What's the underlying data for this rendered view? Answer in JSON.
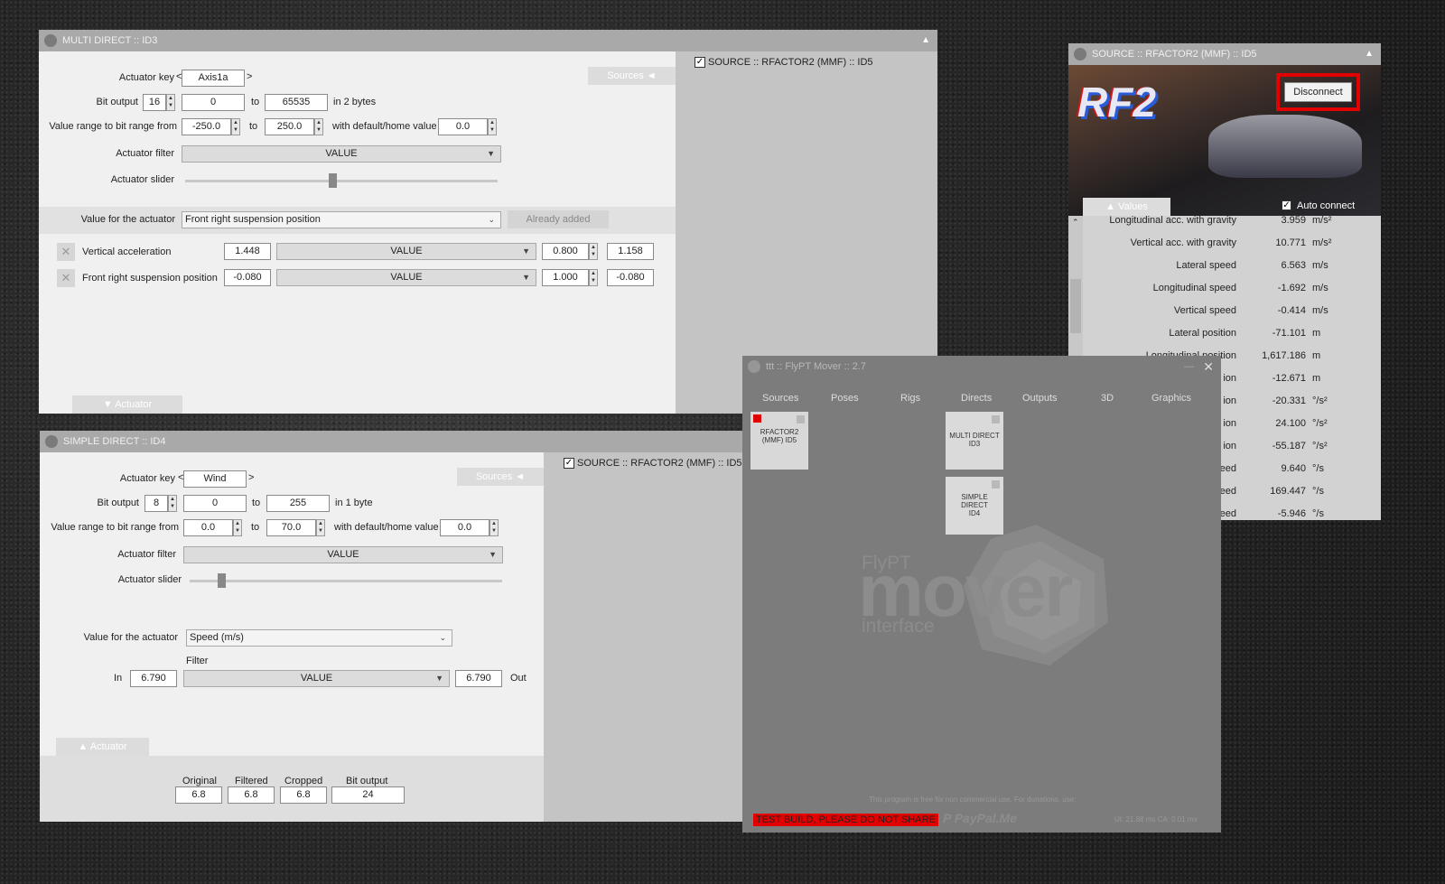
{
  "multi_direct": {
    "title": "MULTI DIRECT :: ID3",
    "actuator_key_label": "Actuator key",
    "actuator_key_value": "Axis1a",
    "bit_output_label": "Bit output",
    "bit_output_value": "16",
    "bit_from": "0",
    "to_label": "to",
    "bit_to": "65535",
    "bytes_label": "in 2 bytes",
    "range_label": "Value range to bit range from",
    "range_from": "-250.0",
    "range_to": "250.0",
    "default_label": "with default/home value",
    "default_value": "0.0",
    "filter_label": "Actuator filter",
    "filter_value": "VALUE",
    "slider_label": "Actuator slider",
    "slider_level": 0.47,
    "sources_tab": "Sources",
    "value_label": "Value for the actuator",
    "value_select": "Front right suspension position",
    "already_added": "Already added",
    "rows": [
      {
        "name": "Vertical acceleration",
        "input": "1.448",
        "filter": "VALUE",
        "gain": "0.800",
        "output": "1.158"
      },
      {
        "name": "Front right suspension position",
        "input": "-0.080",
        "filter": "VALUE",
        "gain": "1.000",
        "output": "-0.080"
      }
    ],
    "actuator_tab": "Actuator",
    "source_check": "SOURCE :: RFACTOR2 (MMF) :: ID5"
  },
  "simple_direct": {
    "title": "SIMPLE DIRECT :: ID4",
    "actuator_key_label": "Actuator key",
    "actuator_key_value": "Wind",
    "bit_output_label": "Bit output",
    "bit_output_value": "8",
    "bit_from": "0",
    "to_label": "to",
    "bit_to": "255",
    "bytes_label": "in 1 byte",
    "range_label": "Value range to bit range from",
    "range_from": "0.0",
    "range_to": "70.0",
    "default_label": "with default/home value",
    "default_value": "0.0",
    "filter_label": "Actuator filter",
    "filter_value": "VALUE",
    "slider_label": "Actuator slider",
    "slider_level": 0.1,
    "sources_tab": "Sources",
    "value_label": "Value for the actuator",
    "value_select": "Speed (m/s)",
    "filter_caption": "Filter",
    "in_label": "In",
    "in_value": "6.790",
    "mid_filter": "VALUE",
    "out_value": "6.790",
    "out_label": "Out",
    "actuator_tab": "Actuator",
    "stats": [
      {
        "label": "Original",
        "value": "6.8"
      },
      {
        "label": "Filtered",
        "value": "6.8"
      },
      {
        "label": "Cropped",
        "value": "6.8"
      },
      {
        "label": "Bit output",
        "value": "24"
      }
    ],
    "source_check": "SOURCE :: RFACTOR2 (MMF) :: ID5"
  },
  "source_win": {
    "title": "SOURCE :: RFACTOR2 (MMF) :: ID5",
    "disconnect": "Disconnect",
    "values_tab": "Values",
    "auto_connect": "Auto connect",
    "logo_text": "RF2",
    "values": [
      {
        "name": "Longitudinal acc. with gravity",
        "value": "3.959",
        "unit": "m/s²"
      },
      {
        "name": "Vertical acc. with gravity",
        "value": "10.771",
        "unit": "m/s²"
      },
      {
        "name": "Lateral speed",
        "value": "6.563",
        "unit": "m/s"
      },
      {
        "name": "Longitudinal speed",
        "value": "-1.692",
        "unit": "m/s"
      },
      {
        "name": "Vertical speed",
        "value": "-0.414",
        "unit": "m/s"
      },
      {
        "name": "Lateral position",
        "value": "-71.101",
        "unit": "m"
      },
      {
        "name": "Longitudinal position",
        "value": "1,617.186",
        "unit": "m"
      },
      {
        "name": "",
        "value": "-12.671",
        "unit": "m"
      },
      {
        "name": "",
        "value": "-20.331",
        "unit": "°/s²"
      },
      {
        "name": "",
        "value": "24.100",
        "unit": "°/s²"
      },
      {
        "name": "",
        "value": "-55.187",
        "unit": "°/s²"
      },
      {
        "name": "",
        "value": "9.640",
        "unit": "°/s"
      },
      {
        "name": "",
        "value": "169.447",
        "unit": "°/s"
      },
      {
        "name": "",
        "value": "-5.946",
        "unit": "°/s"
      }
    ],
    "partial_suffixes": [
      "ion",
      "ion",
      "ion",
      "ion",
      "eed",
      "eed",
      "eed"
    ]
  },
  "mover": {
    "title": "ttt :: FlyPT Mover :: 2.7",
    "tabs": [
      "Sources",
      "Poses",
      "Rigs",
      "Directs",
      "Outputs",
      "3D",
      "Graphics"
    ],
    "card_source": "RFACTOR2 (MMF) ID5",
    "card_multi": "MULTI DIRECT ID3",
    "card_simple": "SIMPLE DIRECT ID4",
    "logo_top": "FlyPT",
    "logo_main": "mover",
    "logo_sub": "interface",
    "free_note": "This program is free for non commercial use. For donations, use:",
    "test_build": "TEST BUILD, PLEASE DO NOT SHARE",
    "paypal": "PayPal.Me",
    "perf": "UI: 21.88 ms  CA: 0.01 ms",
    "colors": {
      "test_build_bg": "#e30000",
      "disconnect_border": "#e30000"
    }
  }
}
